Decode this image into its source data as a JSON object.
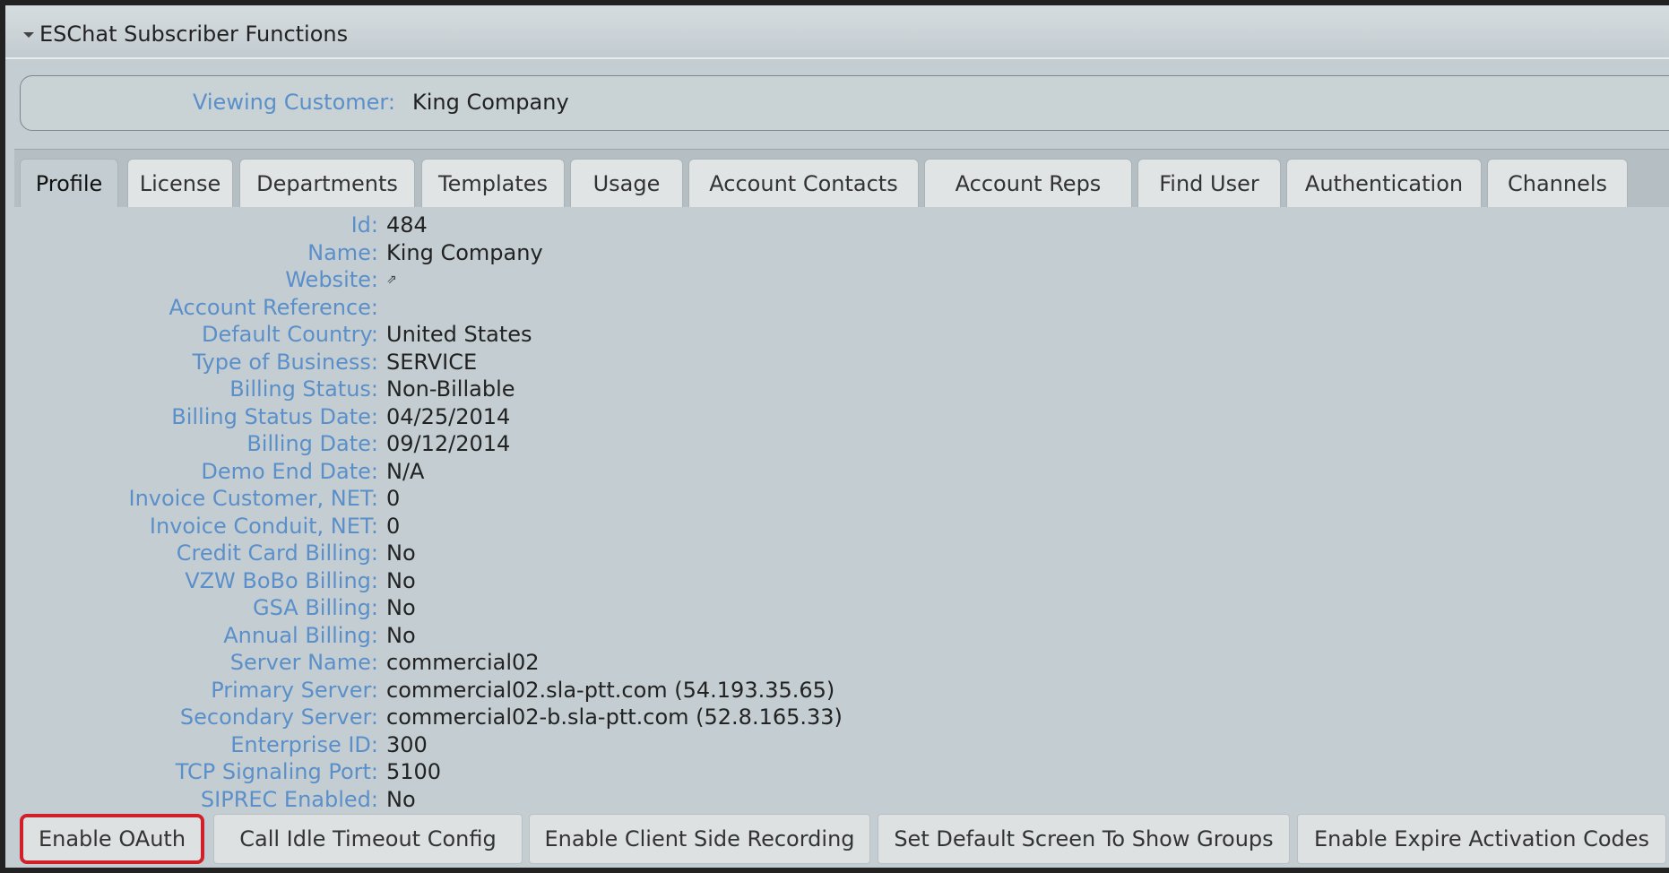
{
  "panel": {
    "title": "ESChat Subscriber Functions"
  },
  "customer": {
    "label": "Viewing Customer:",
    "value": "King Company"
  },
  "tabs": [
    {
      "label": "Profile"
    },
    {
      "label": "License"
    },
    {
      "label": "Departments"
    },
    {
      "label": "Templates"
    },
    {
      "label": "Usage"
    },
    {
      "label": "Account Contacts"
    },
    {
      "label": "Account Reps"
    },
    {
      "label": "Find User"
    },
    {
      "label": "Authentication"
    },
    {
      "label": "Channels"
    }
  ],
  "profile": {
    "fields": [
      {
        "label": "Id:",
        "value": "484"
      },
      {
        "label": "Name:",
        "value": "King Company"
      },
      {
        "label": "Website:",
        "value": "⇗"
      },
      {
        "label": "Account Reference:",
        "value": ""
      },
      {
        "label": "Default Country:",
        "value": "United States"
      },
      {
        "label": "Type of Business:",
        "value": "SERVICE"
      },
      {
        "label": "Billing Status:",
        "value": "Non-Billable"
      },
      {
        "label": "Billing Status Date:",
        "value": "04/25/2014"
      },
      {
        "label": "Billing Date:",
        "value": "09/12/2014"
      },
      {
        "label": "Demo End Date:",
        "value": "N/A"
      },
      {
        "label": "Invoice Customer, NET:",
        "value": "0"
      },
      {
        "label": "Invoice Conduit, NET:",
        "value": "0"
      },
      {
        "label": "Credit Card Billing:",
        "value": "No"
      },
      {
        "label": "VZW BoBo Billing:",
        "value": "No"
      },
      {
        "label": "GSA Billing:",
        "value": "No"
      },
      {
        "label": "Annual Billing:",
        "value": "No"
      },
      {
        "label": "Server Name:",
        "value": "commercial02"
      },
      {
        "label": "Primary Server:",
        "value": "commercial02.sla-ptt.com (54.193.35.65)"
      },
      {
        "label": "Secondary Server:",
        "value": "commercial02-b.sla-ptt.com (52.8.165.33)"
      },
      {
        "label": "Enterprise ID:",
        "value": "300"
      },
      {
        "label": "TCP Signaling Port:",
        "value": "5100"
      },
      {
        "label": "SIPREC Enabled:",
        "value": "No"
      }
    ]
  },
  "actions": [
    {
      "label": "Enable OAuth"
    },
    {
      "label": "Call Idle Timeout Config"
    },
    {
      "label": "Enable Client Side Recording"
    },
    {
      "label": "Set Default Screen To Show Groups"
    },
    {
      "label": "Enable Expire Activation Codes"
    }
  ],
  "colors": {
    "label_blue": "#5b8fc9",
    "highlight_red": "#d0202a",
    "panel_bg": "#c4ced2"
  }
}
